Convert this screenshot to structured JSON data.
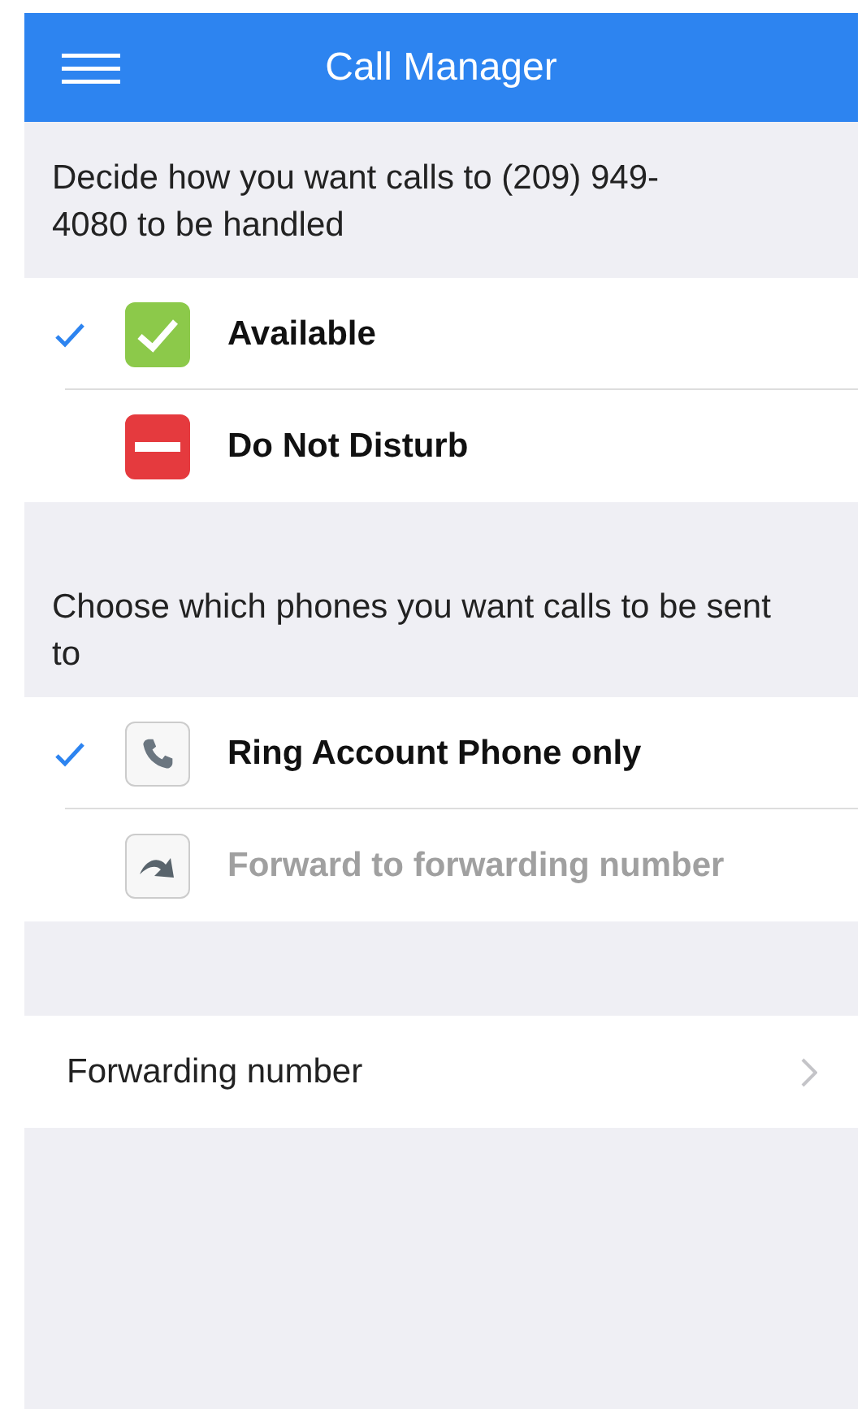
{
  "header": {
    "title": "Call Manager"
  },
  "sections": [
    {
      "description": "Decide how you want calls to (209) 949-4080 to be handled",
      "options": [
        {
          "label": "Available",
          "kind": "available",
          "selected": true,
          "disabled": false
        },
        {
          "label": "Do Not Disturb",
          "kind": "dnd",
          "selected": false,
          "disabled": false
        }
      ]
    },
    {
      "description": "Choose which phones you want calls to be sent to",
      "options": [
        {
          "label": "Ring Account Phone only",
          "kind": "phone",
          "selected": true,
          "disabled": false
        },
        {
          "label": "Forward to forwarding number",
          "kind": "forward",
          "selected": false,
          "disabled": true
        }
      ]
    }
  ],
  "forwarding": {
    "label": "Forwarding number"
  }
}
